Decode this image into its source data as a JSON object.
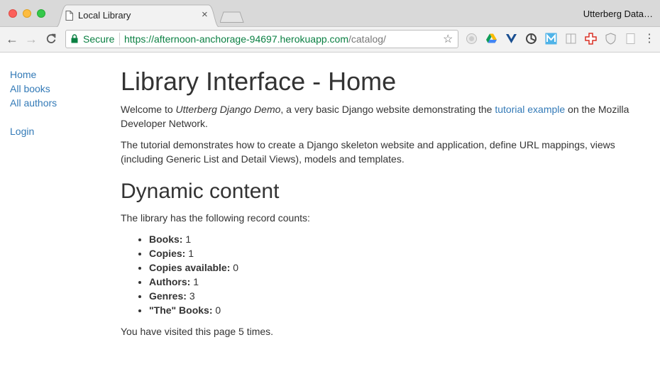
{
  "browser": {
    "tab_title": "Local Library",
    "tab_close": "×",
    "profile_name": "Utterberg Data…",
    "secure_label": "Secure",
    "url_scheme_host": "https://afternoon-anchorage-94697.herokuapp.com",
    "url_path": "/catalog/",
    "extensions": [
      "ad-block-icon",
      "google-drive-icon",
      "vue-devtools-icon",
      "refresh-spinner-icon",
      "m-app-icon",
      "reader-icon",
      "medical-cross-icon",
      "shield-icon",
      "page-icon"
    ],
    "colors": {
      "secure_green": "#0b8043",
      "link_blue": "#337ab7"
    }
  },
  "sidebar": {
    "items": [
      {
        "label": "Home"
      },
      {
        "label": "All books"
      },
      {
        "label": "All authors"
      }
    ],
    "login_label": "Login"
  },
  "main": {
    "title": "Library Interface - Home",
    "intro_pre": "Welcome to ",
    "intro_site": "Utterberg Django Demo",
    "intro_mid": ", a very basic Django website demonstrating the ",
    "intro_link": "tutorial example",
    "intro_post": " on the Mozilla Developer Network.",
    "tutorial_text": "The tutorial demonstrates how to create a Django skeleton website and application, define URL mappings, views (including Generic List and Detail Views), models and templates.",
    "dynamic_heading": "Dynamic content",
    "counts_intro": "The library has the following record counts:",
    "counts": [
      {
        "label": "Books:",
        "value": "1"
      },
      {
        "label": "Copies:",
        "value": "1"
      },
      {
        "label": "Copies available:",
        "value": "0"
      },
      {
        "label": "Authors:",
        "value": "1"
      },
      {
        "label": "Genres:",
        "value": "3"
      },
      {
        "label": "\"The\" Books:",
        "value": "0"
      }
    ],
    "visits_pre": "You have visited this page ",
    "visits_count": "5",
    "visits_post": " times."
  }
}
